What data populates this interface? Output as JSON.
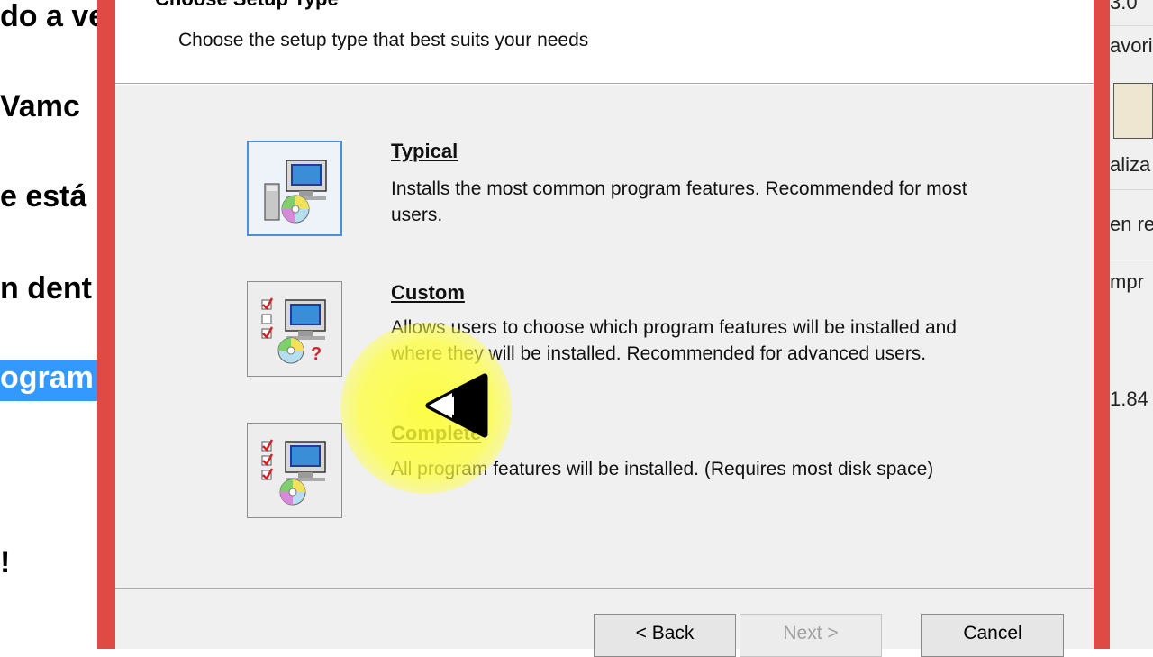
{
  "background_left": {
    "lines": [
      {
        "text": "do a ve",
        "selected": false
      },
      {
        "text": "Vamc",
        "selected": false
      },
      {
        "text": "e está",
        "selected": false
      },
      {
        "text": "n dent",
        "selected": false
      },
      {
        "text": "ogram",
        "selected": true
      },
      {
        "text": "!",
        "selected": false
      }
    ]
  },
  "background_right": {
    "texts": [
      "3.0",
      "avori",
      "aliza",
      "en re",
      "mpr",
      "1.84"
    ]
  },
  "dialog": {
    "header_title": "Choose Setup Type",
    "header_subtitle": "Choose the setup type that best suits your needs",
    "options": [
      {
        "title": "Typical",
        "description": "Installs the most common program features. Recommended for most users.",
        "icon": "typical-setup-icon",
        "focused": true
      },
      {
        "title": "Custom",
        "description": "Allows users to choose which program features will be installed and where they will be installed. Recommended for advanced users.",
        "icon": "custom-setup-icon",
        "focused": false
      },
      {
        "title": "Complete",
        "description": "All program features will be installed.  (Requires most disk space)",
        "icon": "complete-setup-icon",
        "focused": false
      }
    ],
    "buttons": {
      "back": "< Back",
      "next": "Next >",
      "cancel": "Cancel"
    }
  },
  "colors": {
    "frame": "#e04a44",
    "dialog_bg": "#f0f0f0",
    "focus_border": "#4a8fd8",
    "selection": "#3399ff",
    "highlight": "#ffff28"
  }
}
